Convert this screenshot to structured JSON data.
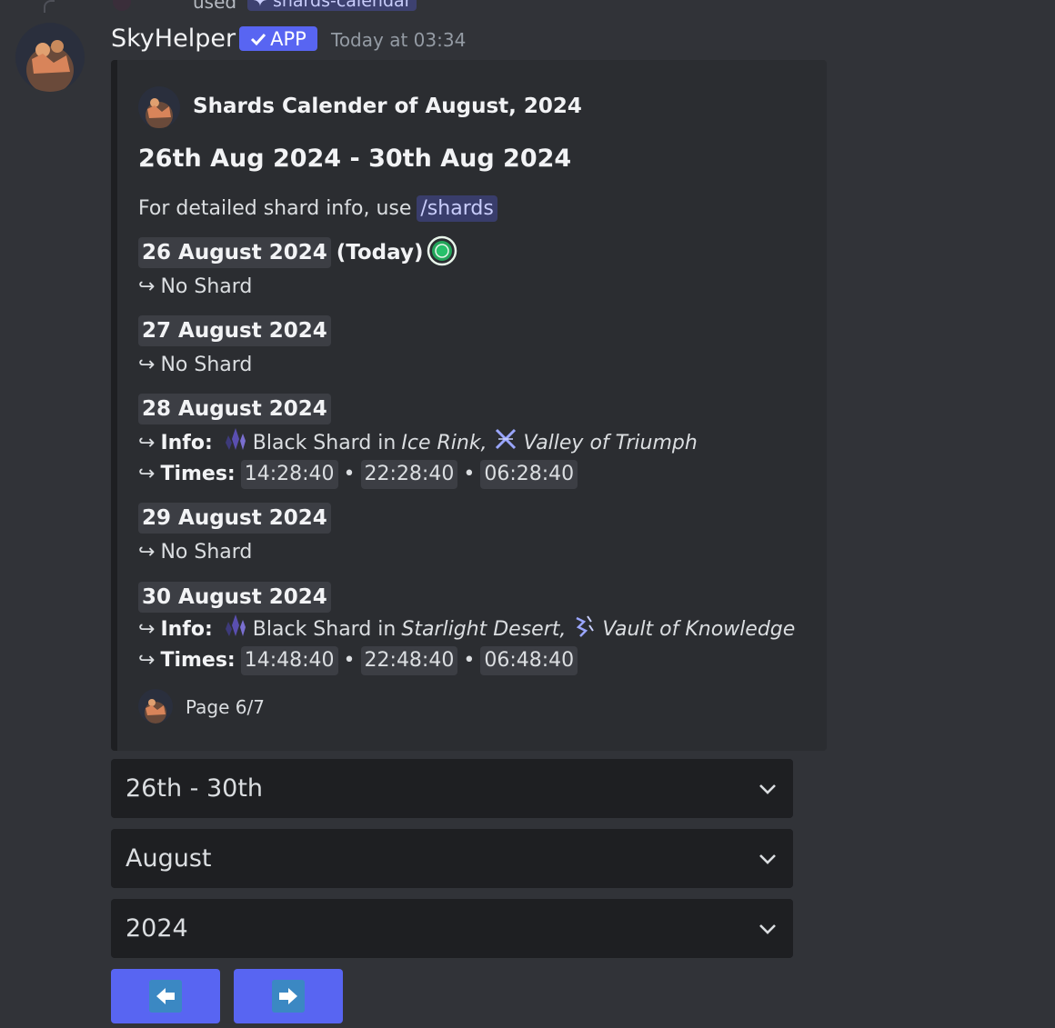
{
  "previous": {
    "used_label": "used",
    "command": "shards-calendar"
  },
  "message": {
    "username": "SkyHelper",
    "badge": "APP",
    "timestamp": "Today at 03:34"
  },
  "embed": {
    "author": "Shards Calender of August, 2024",
    "title": "26th Aug 2024 - 30th Aug 2024",
    "desc_prefix": "For detailed shard info, use",
    "desc_command": "/shards",
    "days": [
      {
        "date": "26 August 2024",
        "today": "(Today)",
        "status": "No Shard"
      },
      {
        "date": "27 August 2024",
        "status": "No Shard"
      },
      {
        "date": "28 August 2024",
        "info_label": "Info:",
        "shard_text": "Black Shard in",
        "place": "Ice Rink,",
        "realm": "Valley of Triumph",
        "times_label": "Times:",
        "times": [
          "14:28:40",
          "22:28:40",
          "06:28:40"
        ]
      },
      {
        "date": "29 August 2024",
        "status": "No Shard"
      },
      {
        "date": "30 August 2024",
        "info_label": "Info:",
        "shard_text": "Black Shard in",
        "place": "Starlight Desert,",
        "realm": "Vault of Knowledge",
        "times_label": "Times:",
        "times": [
          "14:48:40",
          "22:48:40",
          "06:48:40"
        ]
      }
    ],
    "footer": "Page 6/7"
  },
  "selects": {
    "range": "26th - 30th",
    "month": "August",
    "year": "2024"
  },
  "colors": {
    "blurple": "#5865f2",
    "today_green": "#23a55a"
  },
  "icons": {
    "prev": "left-arrow-icon",
    "next": "right-arrow-icon"
  }
}
